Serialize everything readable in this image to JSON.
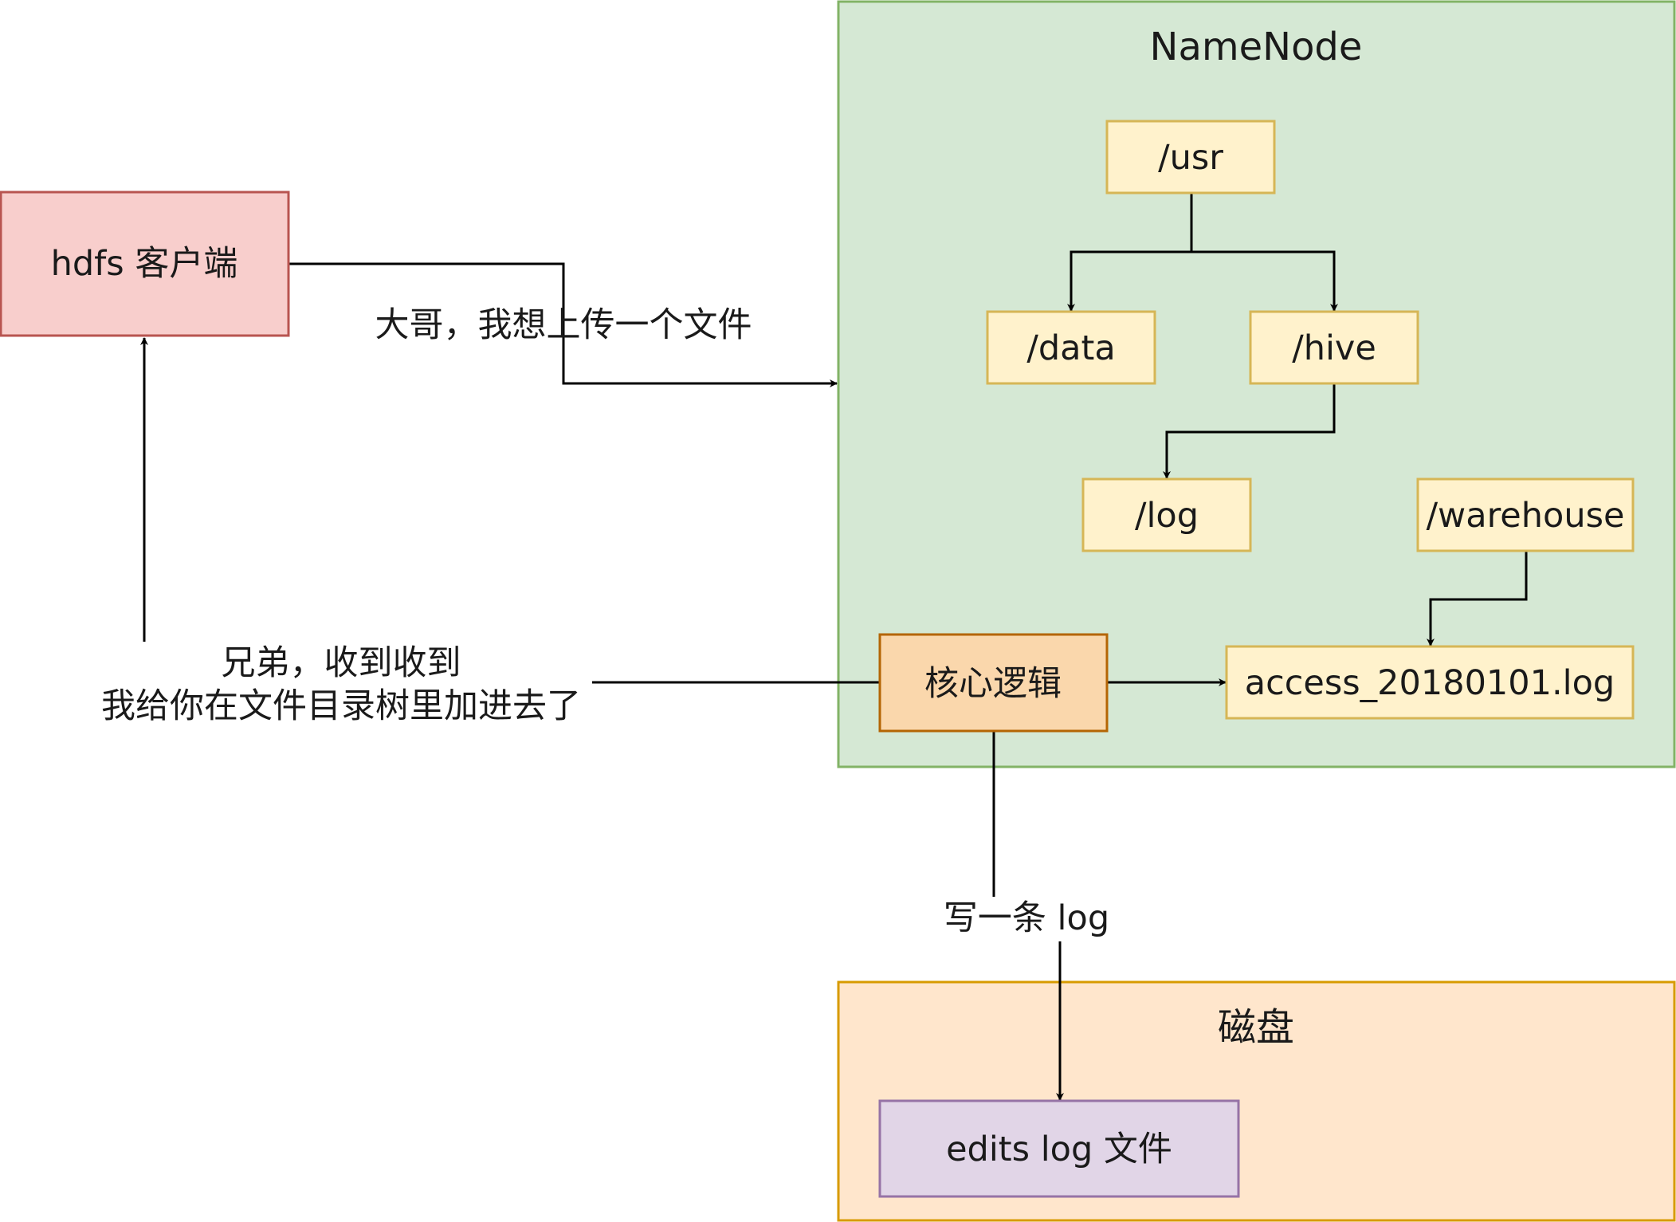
{
  "namenode": {
    "title": "NameNode",
    "fill": "#d5e8d4",
    "stroke": "#82b366",
    "tree": {
      "usr": "/usr",
      "data": "/data",
      "hive": "/hive",
      "log": "/log",
      "warehouse": "/warehouse",
      "access": "access_20180101.log"
    },
    "node_fill": "#fff2cc",
    "node_stroke": "#d6b656",
    "core": "核心逻辑",
    "core_fill": "#fad7ac",
    "core_stroke": "#b46504"
  },
  "client": {
    "label": "hdfs 客户端",
    "fill": "#f8cecc",
    "stroke": "#b85450"
  },
  "disk": {
    "title": "磁盘",
    "fill": "#ffe6cc",
    "stroke": "#d79b00",
    "edits": "edits log 文件",
    "edits_fill": "#e1d5e7",
    "edits_stroke": "#9673a6"
  },
  "edges": {
    "request": "大哥，我想上传一个文件",
    "reply_line1": "兄弟，收到收到",
    "reply_line2": "我给你在文件目录树里加进去了",
    "write_log": "写一条 log"
  }
}
